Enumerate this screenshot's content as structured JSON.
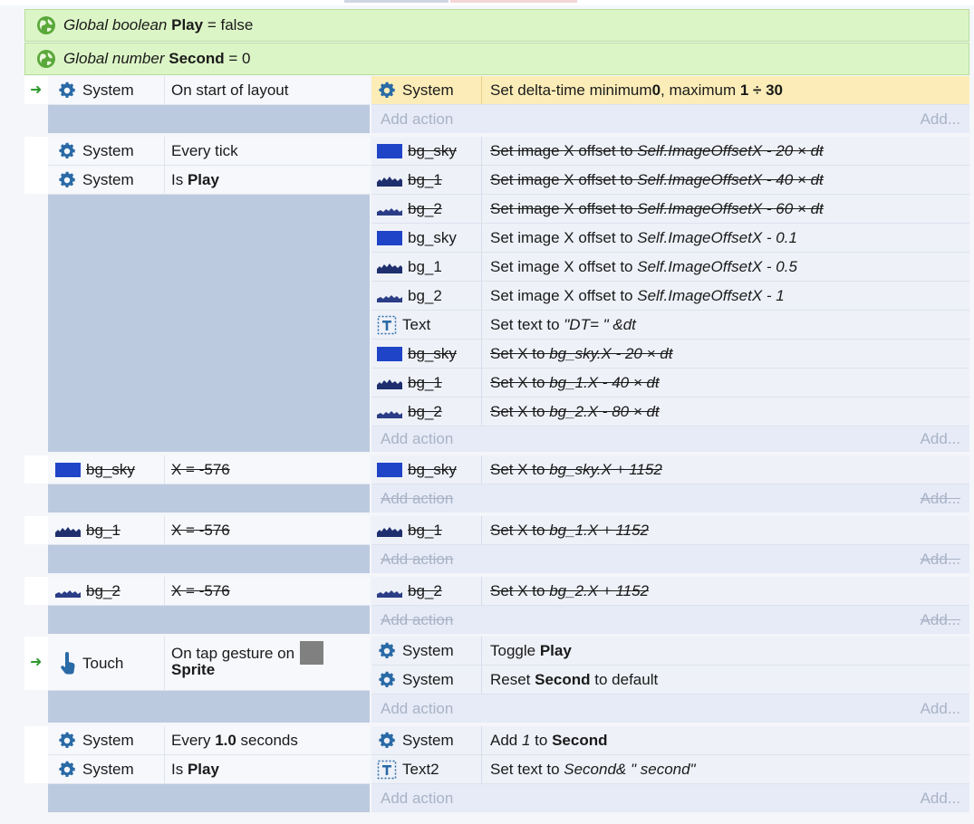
{
  "globals": [
    {
      "type_label": "Global boolean",
      "name": "Play",
      "value": "= false"
    },
    {
      "type_label": "Global number",
      "name": "Second",
      "value": "= 0"
    }
  ],
  "add_action": {
    "left": "Add action",
    "right": "Add..."
  },
  "events": {
    "e1": {
      "c1_obj": "System",
      "c1_text": "On start of layout",
      "a1_obj": "System",
      "a1_pre": "Set delta-time minimum ",
      "a1_min": "0",
      "a1_mid": ", maximum ",
      "a1_max": "1 ÷ 30"
    },
    "e2": {
      "c1_obj": "System",
      "c1_text": "Every tick",
      "c2_obj": "System",
      "c2_pre": "Is ",
      "c2_var": "Play",
      "actions": [
        {
          "obj": "bg_sky",
          "pre": "Set image X offset to ",
          "expr": "Self.ImageOffsetX - 20 × dt"
        },
        {
          "obj": "bg_1",
          "pre": "Set image X offset to ",
          "expr": "Self.ImageOffsetX - 40 × dt"
        },
        {
          "obj": "bg_2",
          "pre": "Set image X offset to ",
          "expr": "Self.ImageOffsetX - 60 × dt"
        },
        {
          "obj": "bg_sky",
          "pre": "Set image X offset to ",
          "expr": "Self.ImageOffsetX - 0.1"
        },
        {
          "obj": "bg_1",
          "pre": "Set image X offset to ",
          "expr": "Self.ImageOffsetX - 0.5"
        },
        {
          "obj": "bg_2",
          "pre": "Set image X offset to ",
          "expr": "Self.ImageOffsetX - 1"
        },
        {
          "obj": "Text",
          "pre": "Set text to ",
          "expr": "\"DT= \" &dt"
        },
        {
          "obj": "bg_sky",
          "pre": "Set X to ",
          "expr": "bg_sky.X - 20 × dt"
        },
        {
          "obj": "bg_1",
          "pre": "Set X to ",
          "expr": "bg_1.X - 40 × dt"
        },
        {
          "obj": "bg_2",
          "pre": "Set X to ",
          "expr": "bg_2.X - 80 × dt"
        }
      ]
    },
    "e3": {
      "c_obj": "bg_sky",
      "c_text": "X = -576",
      "a_obj": "bg_sky",
      "a_pre": "Set X to ",
      "a_expr": "bg_sky.X + 1152"
    },
    "e4": {
      "c_obj": "bg_1",
      "c_text": "X = -576",
      "a_obj": "bg_1",
      "a_pre": "Set X to ",
      "a_expr": "bg_1.X + 1152"
    },
    "e5": {
      "c_obj": "bg_2",
      "c_text": "X = -576",
      "a_obj": "bg_2",
      "a_pre": "Set X to ",
      "a_expr": "bg_2.X + 1152"
    },
    "e6": {
      "c_obj": "Touch",
      "c_line1": "On tap gesture on",
      "c_line2": "Sprite",
      "a1_obj": "System",
      "a1_pre": "Toggle ",
      "a1_var": "Play",
      "a2_obj": "System",
      "a2_pre": "Reset ",
      "a2_var": "Second",
      "a2_post": " to default"
    },
    "e7": {
      "c1_obj": "System",
      "c1_pre": "Every ",
      "c1_val": "1.0",
      "c1_post": " seconds",
      "c2_obj": "System",
      "c2_pre": "Is ",
      "c2_var": "Play",
      "a1_obj": "System",
      "a1_pre": "Add ",
      "a1_val": "1",
      "a1_mid": " to ",
      "a1_var": "Second",
      "a2_obj": "Text2",
      "a2_pre": "Set text to ",
      "a2_expr": "Second& \" second\""
    }
  },
  "colors": {
    "global_bg": "#dcf5c6",
    "highlight": "#fcedb8",
    "condition_area": "#bccadf",
    "action_area": "#e6ebf7",
    "sky_icon": "#1f44c8",
    "trigger_arrow": "#2d9a2d"
  }
}
